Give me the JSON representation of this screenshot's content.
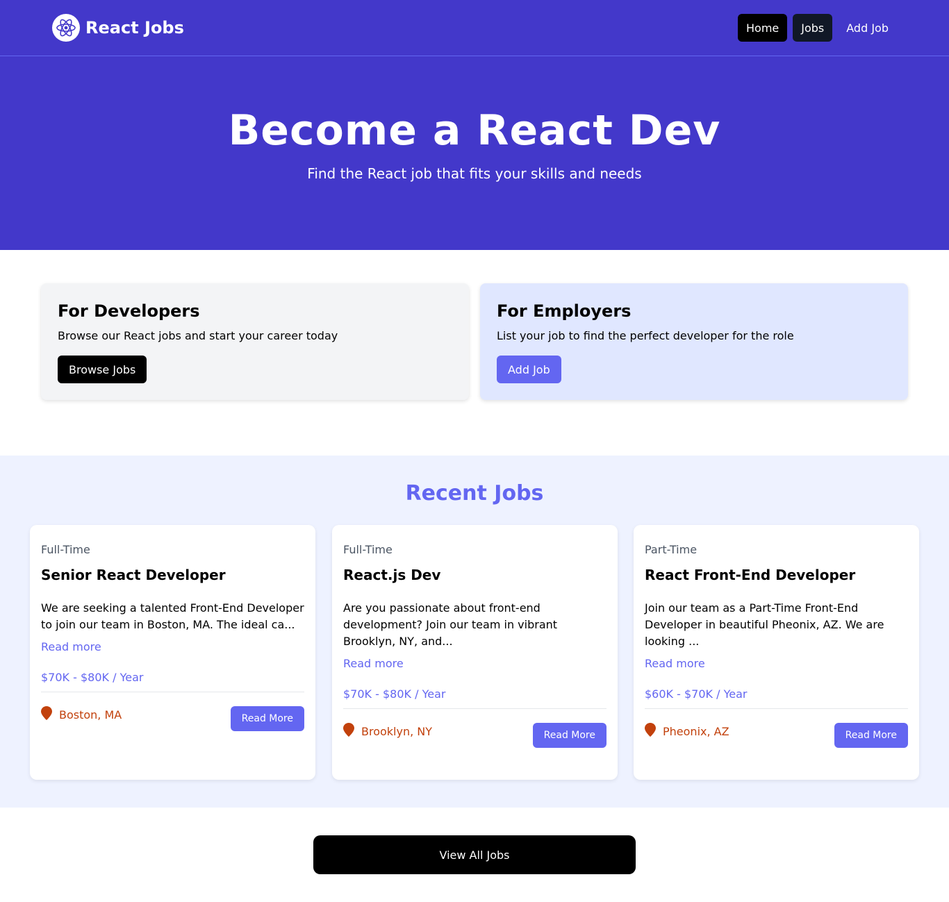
{
  "nav": {
    "brand": "React Jobs",
    "logo_icon": "react-atom-icon",
    "links": [
      {
        "label": "Home"
      },
      {
        "label": "Jobs"
      },
      {
        "label": "Add Job"
      }
    ]
  },
  "hero": {
    "title": "Become a React Dev",
    "subtitle": "Find the React job that fits your skills and needs"
  },
  "cards": {
    "developers": {
      "title": "For Developers",
      "text": "Browse our React jobs and start your career today",
      "button": "Browse Jobs"
    },
    "employers": {
      "title": "For Employers",
      "text": "List your job to find the perfect developer for the role",
      "button": "Add Job"
    }
  },
  "recent": {
    "title": "Recent Jobs",
    "jobs": [
      {
        "type": "Full-Time",
        "title": "Senior React Developer",
        "description": "We are seeking a talented Front-End Developer to join our team in Boston, MA. The ideal ca...",
        "read_more_link": "Read more",
        "salary": "$70K - $80K / Year",
        "location": "Boston, MA",
        "button": "Read More"
      },
      {
        "type": "Full-Time",
        "title": "React.js Dev",
        "description": "Are you passionate about front-end development? Join our team in vibrant Brooklyn, NY, and...",
        "read_more_link": "Read more",
        "salary": "$70K - $80K / Year",
        "location": "Brooklyn, NY",
        "button": "Read More"
      },
      {
        "type": "Part-Time",
        "title": "React Front-End Developer",
        "description": "Join our team as a Part-Time Front-End Developer in beautiful Pheonix, AZ. We are looking ...",
        "read_more_link": "Read more",
        "salary": "$60K - $70K / Year",
        "location": "Pheonix, AZ",
        "button": "Read More"
      }
    ]
  },
  "view_all": "View All Jobs",
  "colors": {
    "primary": "#4338ca",
    "accent": "#6366f1",
    "location": "#c2410c"
  }
}
